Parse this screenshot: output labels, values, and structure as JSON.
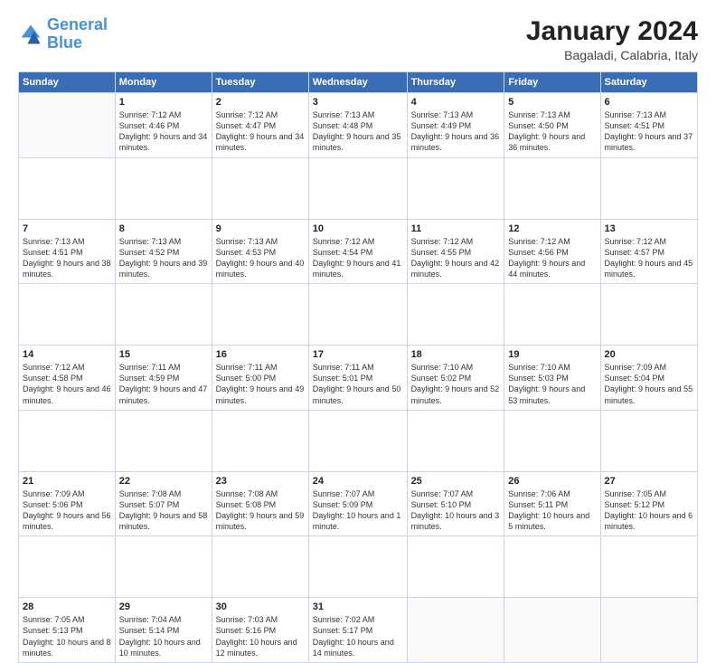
{
  "logo": {
    "line1": "General",
    "line2": "Blue"
  },
  "title": "January 2024",
  "subtitle": "Bagaladi, Calabria, Italy",
  "weekdays": [
    "Sunday",
    "Monday",
    "Tuesday",
    "Wednesday",
    "Thursday",
    "Friday",
    "Saturday"
  ],
  "weeks": [
    [
      {
        "day": "",
        "sunrise": "",
        "sunset": "",
        "daylight": ""
      },
      {
        "day": "1",
        "sunrise": "Sunrise: 7:12 AM",
        "sunset": "Sunset: 4:46 PM",
        "daylight": "Daylight: 9 hours and 34 minutes."
      },
      {
        "day": "2",
        "sunrise": "Sunrise: 7:12 AM",
        "sunset": "Sunset: 4:47 PM",
        "daylight": "Daylight: 9 hours and 34 minutes."
      },
      {
        "day": "3",
        "sunrise": "Sunrise: 7:13 AM",
        "sunset": "Sunset: 4:48 PM",
        "daylight": "Daylight: 9 hours and 35 minutes."
      },
      {
        "day": "4",
        "sunrise": "Sunrise: 7:13 AM",
        "sunset": "Sunset: 4:49 PM",
        "daylight": "Daylight: 9 hours and 36 minutes."
      },
      {
        "day": "5",
        "sunrise": "Sunrise: 7:13 AM",
        "sunset": "Sunset: 4:50 PM",
        "daylight": "Daylight: 9 hours and 36 minutes."
      },
      {
        "day": "6",
        "sunrise": "Sunrise: 7:13 AM",
        "sunset": "Sunset: 4:51 PM",
        "daylight": "Daylight: 9 hours and 37 minutes."
      }
    ],
    [
      {
        "day": "7",
        "sunrise": "Sunrise: 7:13 AM",
        "sunset": "Sunset: 4:51 PM",
        "daylight": "Daylight: 9 hours and 38 minutes."
      },
      {
        "day": "8",
        "sunrise": "Sunrise: 7:13 AM",
        "sunset": "Sunset: 4:52 PM",
        "daylight": "Daylight: 9 hours and 39 minutes."
      },
      {
        "day": "9",
        "sunrise": "Sunrise: 7:13 AM",
        "sunset": "Sunset: 4:53 PM",
        "daylight": "Daylight: 9 hours and 40 minutes."
      },
      {
        "day": "10",
        "sunrise": "Sunrise: 7:12 AM",
        "sunset": "Sunset: 4:54 PM",
        "daylight": "Daylight: 9 hours and 41 minutes."
      },
      {
        "day": "11",
        "sunrise": "Sunrise: 7:12 AM",
        "sunset": "Sunset: 4:55 PM",
        "daylight": "Daylight: 9 hours and 42 minutes."
      },
      {
        "day": "12",
        "sunrise": "Sunrise: 7:12 AM",
        "sunset": "Sunset: 4:56 PM",
        "daylight": "Daylight: 9 hours and 44 minutes."
      },
      {
        "day": "13",
        "sunrise": "Sunrise: 7:12 AM",
        "sunset": "Sunset: 4:57 PM",
        "daylight": "Daylight: 9 hours and 45 minutes."
      }
    ],
    [
      {
        "day": "14",
        "sunrise": "Sunrise: 7:12 AM",
        "sunset": "Sunset: 4:58 PM",
        "daylight": "Daylight: 9 hours and 46 minutes."
      },
      {
        "day": "15",
        "sunrise": "Sunrise: 7:11 AM",
        "sunset": "Sunset: 4:59 PM",
        "daylight": "Daylight: 9 hours and 47 minutes."
      },
      {
        "day": "16",
        "sunrise": "Sunrise: 7:11 AM",
        "sunset": "Sunset: 5:00 PM",
        "daylight": "Daylight: 9 hours and 49 minutes."
      },
      {
        "day": "17",
        "sunrise": "Sunrise: 7:11 AM",
        "sunset": "Sunset: 5:01 PM",
        "daylight": "Daylight: 9 hours and 50 minutes."
      },
      {
        "day": "18",
        "sunrise": "Sunrise: 7:10 AM",
        "sunset": "Sunset: 5:02 PM",
        "daylight": "Daylight: 9 hours and 52 minutes."
      },
      {
        "day": "19",
        "sunrise": "Sunrise: 7:10 AM",
        "sunset": "Sunset: 5:03 PM",
        "daylight": "Daylight: 9 hours and 53 minutes."
      },
      {
        "day": "20",
        "sunrise": "Sunrise: 7:09 AM",
        "sunset": "Sunset: 5:04 PM",
        "daylight": "Daylight: 9 hours and 55 minutes."
      }
    ],
    [
      {
        "day": "21",
        "sunrise": "Sunrise: 7:09 AM",
        "sunset": "Sunset: 5:06 PM",
        "daylight": "Daylight: 9 hours and 56 minutes."
      },
      {
        "day": "22",
        "sunrise": "Sunrise: 7:08 AM",
        "sunset": "Sunset: 5:07 PM",
        "daylight": "Daylight: 9 hours and 58 minutes."
      },
      {
        "day": "23",
        "sunrise": "Sunrise: 7:08 AM",
        "sunset": "Sunset: 5:08 PM",
        "daylight": "Daylight: 9 hours and 59 minutes."
      },
      {
        "day": "24",
        "sunrise": "Sunrise: 7:07 AM",
        "sunset": "Sunset: 5:09 PM",
        "daylight": "Daylight: 10 hours and 1 minute."
      },
      {
        "day": "25",
        "sunrise": "Sunrise: 7:07 AM",
        "sunset": "Sunset: 5:10 PM",
        "daylight": "Daylight: 10 hours and 3 minutes."
      },
      {
        "day": "26",
        "sunrise": "Sunrise: 7:06 AM",
        "sunset": "Sunset: 5:11 PM",
        "daylight": "Daylight: 10 hours and 5 minutes."
      },
      {
        "day": "27",
        "sunrise": "Sunrise: 7:05 AM",
        "sunset": "Sunset: 5:12 PM",
        "daylight": "Daylight: 10 hours and 6 minutes."
      }
    ],
    [
      {
        "day": "28",
        "sunrise": "Sunrise: 7:05 AM",
        "sunset": "Sunset: 5:13 PM",
        "daylight": "Daylight: 10 hours and 8 minutes."
      },
      {
        "day": "29",
        "sunrise": "Sunrise: 7:04 AM",
        "sunset": "Sunset: 5:14 PM",
        "daylight": "Daylight: 10 hours and 10 minutes."
      },
      {
        "day": "30",
        "sunrise": "Sunrise: 7:03 AM",
        "sunset": "Sunset: 5:16 PM",
        "daylight": "Daylight: 10 hours and 12 minutes."
      },
      {
        "day": "31",
        "sunrise": "Sunrise: 7:02 AM",
        "sunset": "Sunset: 5:17 PM",
        "daylight": "Daylight: 10 hours and 14 minutes."
      },
      {
        "day": "",
        "sunrise": "",
        "sunset": "",
        "daylight": ""
      },
      {
        "day": "",
        "sunrise": "",
        "sunset": "",
        "daylight": ""
      },
      {
        "day": "",
        "sunrise": "",
        "sunset": "",
        "daylight": ""
      }
    ]
  ]
}
